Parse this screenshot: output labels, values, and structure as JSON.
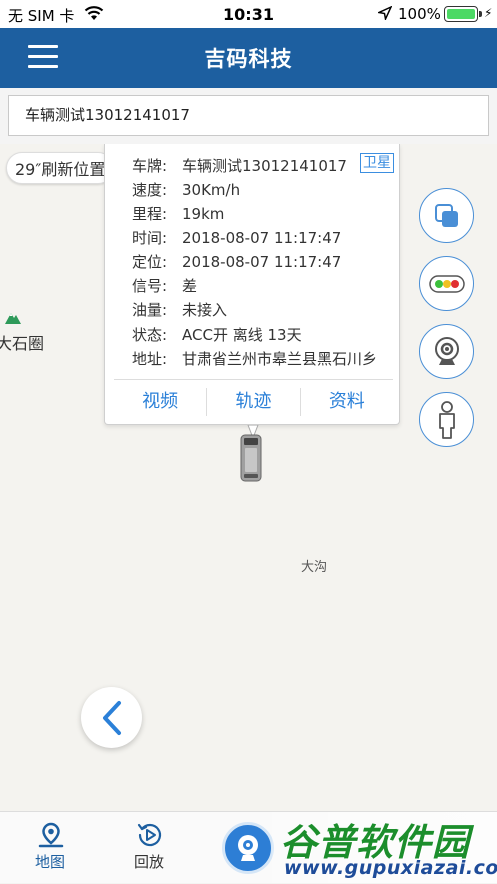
{
  "status_bar": {
    "carrier": "无 SIM 卡",
    "time": "10:31",
    "battery_pct": "100%",
    "battery_level": 1.0
  },
  "nav": {
    "title": "吉码科技"
  },
  "search": {
    "value": "车辆测试13012141017"
  },
  "map": {
    "refresh_label": "29″刷新位置",
    "place_1": "大石圈",
    "place_2": "大沟"
  },
  "info_card": {
    "satellite_label": "卫星",
    "rows": [
      {
        "key": "车牌:",
        "value": "车辆测试13012141017"
      },
      {
        "key": "速度:",
        "value": "30Km/h"
      },
      {
        "key": "里程:",
        "value": "19km"
      },
      {
        "key": "时间:",
        "value": "2018-08-07 11:17:47"
      },
      {
        "key": "定位:",
        "value": "2018-08-07 11:17:47"
      },
      {
        "key": "信号:",
        "value": "差"
      },
      {
        "key": "油量:",
        "value": "未接入"
      },
      {
        "key": "状态:",
        "value": "ACC开 离线 13天"
      },
      {
        "key": "地址:",
        "value": "甘肃省兰州市皋兰县黑石川乡"
      }
    ],
    "actions": [
      "视频",
      "轨迹",
      "资料"
    ]
  },
  "tabs": [
    {
      "label": "地图",
      "icon": "map-pin-icon",
      "active": true
    },
    {
      "label": "回放",
      "icon": "replay-icon",
      "active": false
    }
  ],
  "colors": {
    "nav_bg": "#1d5fa0",
    "accent": "#2b80d8",
    "active_tab": "#1d5fa0"
  },
  "watermark": {
    "title": "谷普软件园",
    "url": "www.gupuxiazai.com"
  }
}
